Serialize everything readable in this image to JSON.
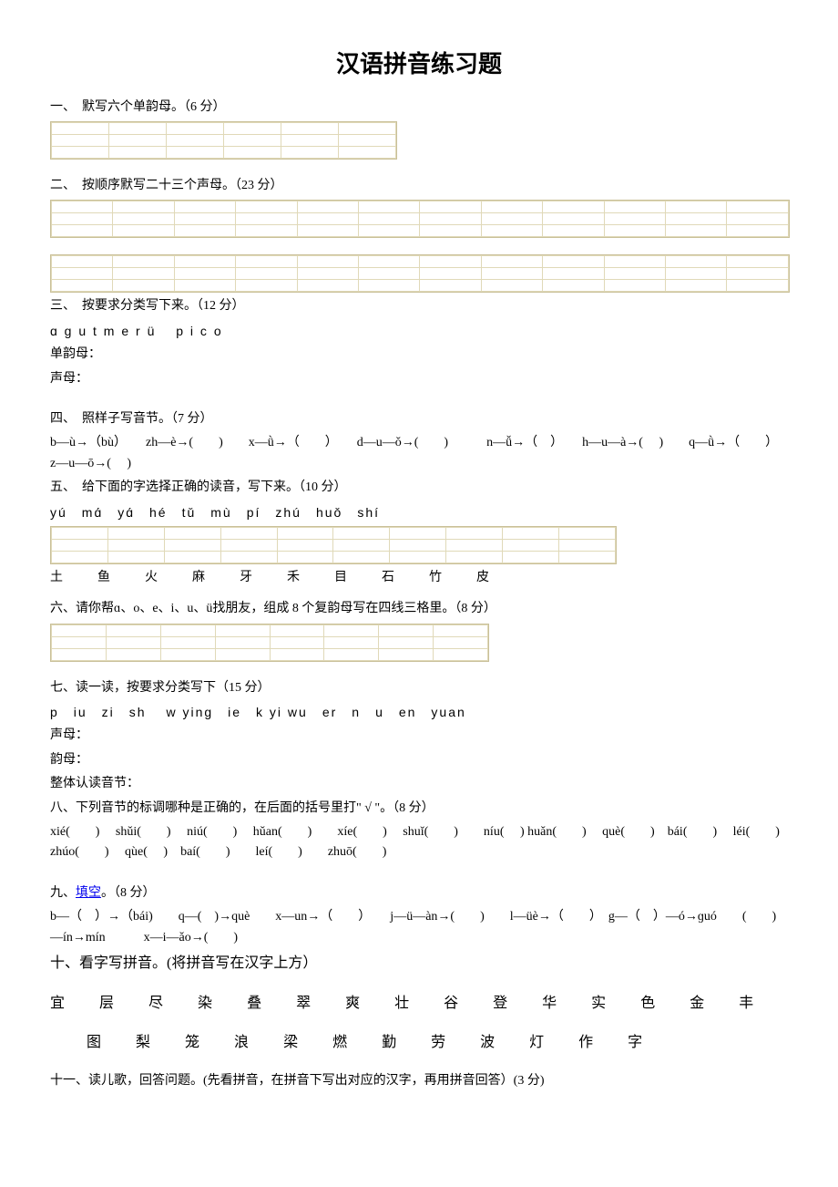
{
  "title": "汉语拼音练习题",
  "q1": {
    "label": "一、　默写六个单韵母。（6 分）"
  },
  "q2": {
    "label": "二、　按顺序默写二十三个声母。（23 分）"
  },
  "q3": {
    "label": "三、　按要求分类写下来。（12 分）",
    "letters": "ɑ  ɡ  u  t  m  e  r  ü　 p  i  c  o",
    "line1": "单韵母：",
    "line2": "声母："
  },
  "q4": {
    "label": "四、　照样子写音节。（7 分）",
    "content": "b—ù→（bù）　　zh—è→(　　)　　x—ǜ→（　　）　　d—u—ǒ→(　　)　　　n—ǚ→（　）　　h—u—à→(　 )　　q—ǜ→（　　）　　z—u—ō→(　 )"
  },
  "q5": {
    "label": "五、　给下面的字选择正确的读音，写下来。（10 分）",
    "pinyin": "yú　mɑ́　yɑ́　hé　tǔ　mù　pí　zhú　huǒ　shí",
    "chars": [
      "土",
      "鱼",
      "火",
      "麻",
      "牙",
      "禾",
      "目",
      "石",
      "竹",
      "皮"
    ]
  },
  "q6": {
    "label": "六、请你帮ɑ、o、e、i、u、ü找朋友，组成 8 个复韵母写在四线三格里。（8 分）"
  },
  "q7": {
    "label": "七、读一读，按要求分类写下（15 分）",
    "letters": "p　iu　zi　sh　 w ying　ie　k  yi wu　er　n　u　en　yuan",
    "line1": "声母：",
    "line2": "韵母：",
    "line3": "整体认读音节："
  },
  "q8": {
    "label": "八、下列音节的标调哪种是正确的，在后面的括号里打\" √ \"。（8 分）",
    "row1": "xié(　　)　 shǔi(　　)　 niú(　　)　 hǔan(　　)　　xíe(　　)　 shuǐ(　　)　　níu(　 ) huǎn(　　)　 què(　　)　bái(　　)　 léi(　　)　 zhúo(　　)　 qùe(　 )　baí(　　)　　leí(　　)　　zhuō(　　)"
  },
  "q9": {
    "label_pre": "九、",
    "link": "填空",
    "label_post": "。（8 分）",
    "row": "b—（　）→（bái)　　q—(　)→què　　x—un→（　　）　　j—ü—àn→(　　)　　l—üè→（　　）　g—（　）—ó→ɡuó　　(　　)—ín→mín　　　x—i—ǎo→(　　)"
  },
  "q10": {
    "label": "十、看字写拼音。(将拼音写在汉字上方）",
    "chars1": [
      "宜",
      "层",
      "尽",
      "染",
      "叠",
      "翠",
      "爽",
      "壮",
      "谷",
      "登",
      "华",
      "实",
      "色",
      "金",
      "丰"
    ],
    "chars2": [
      "图",
      "梨",
      "笼",
      "浪",
      "梁",
      "燃",
      "勤",
      "劳",
      "波",
      "灯",
      "作",
      "字"
    ]
  },
  "q11": {
    "label": "十一、读儿歌，回答问题。(先看拼音，在拼音下写出对应的汉字，再用拼音回答）(3 分)"
  }
}
